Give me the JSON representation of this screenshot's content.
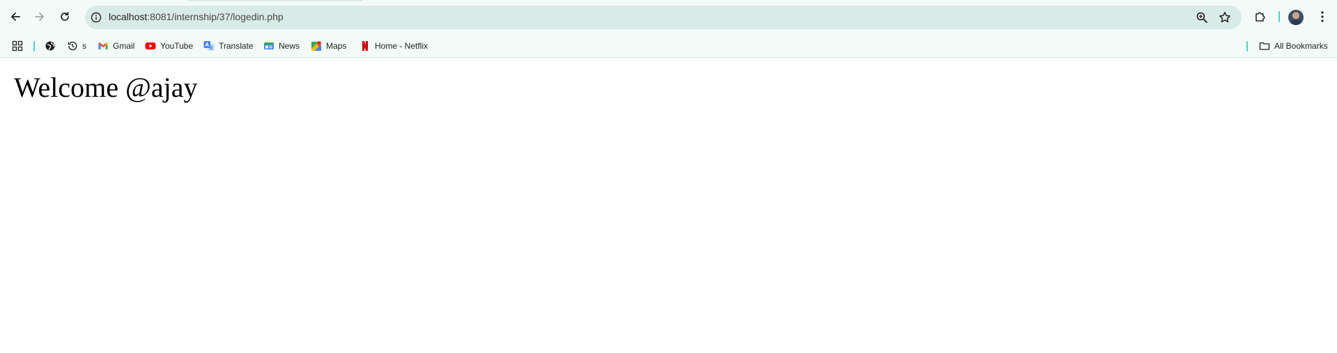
{
  "browser": {
    "url": {
      "host": "localhost",
      "path": ":8081/internship/37/logedin.php"
    },
    "icons": {
      "back": "arrow-left-icon",
      "forward": "arrow-right-icon",
      "reload": "reload-icon",
      "site_info": "info-icon",
      "zoom": "zoom-in-icon",
      "bookmark": "star-icon",
      "extensions": "puzzle-icon",
      "menu": "kebab-menu-icon"
    },
    "colors": {
      "toolbar_bg": "#f3faf8",
      "omnibox_bg": "#d9ebe6",
      "accent": "#4fd1c0"
    }
  },
  "bookmarks": {
    "items": [
      {
        "label": "",
        "icon": "globe-icon"
      },
      {
        "label": "s",
        "icon": "history-icon"
      },
      {
        "label": "Gmail",
        "icon": "gmail-icon"
      },
      {
        "label": "YouTube",
        "icon": "youtube-icon"
      },
      {
        "label": "Translate",
        "icon": "translate-icon"
      },
      {
        "label": "News",
        "icon": "news-icon"
      },
      {
        "label": "Maps",
        "icon": "maps-icon"
      },
      {
        "label": "Home - Netflix",
        "icon": "netflix-icon"
      }
    ],
    "all_bookmarks": "All Bookmarks"
  },
  "page": {
    "heading": "Welcome @ajay"
  }
}
